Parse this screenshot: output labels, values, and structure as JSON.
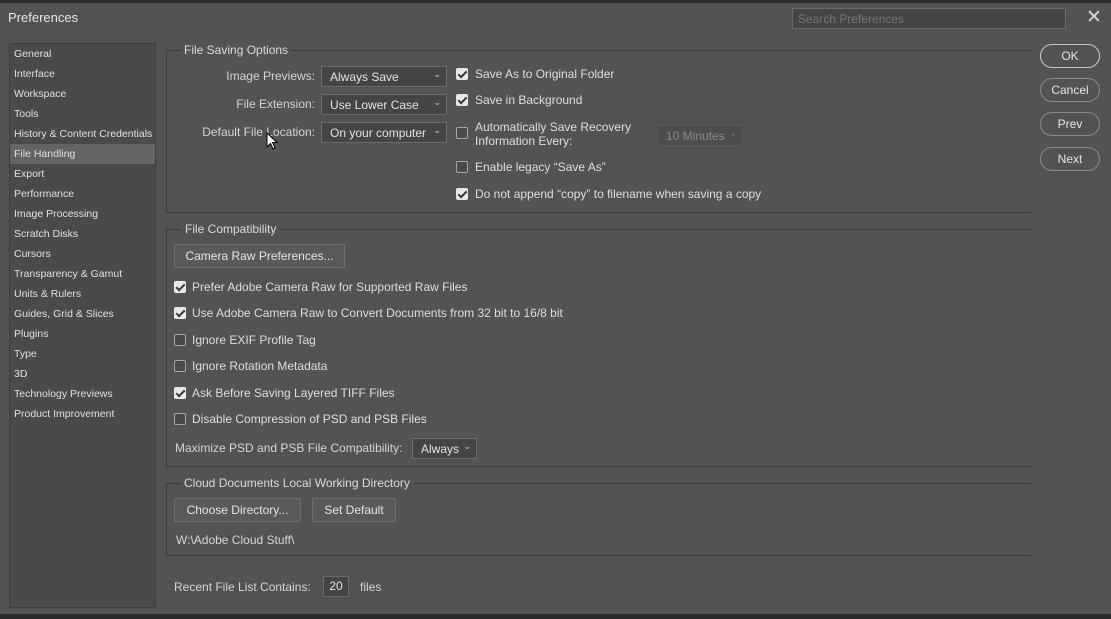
{
  "window": {
    "title": "Preferences",
    "search_placeholder": "Search Preferences",
    "close_glyph": "✕"
  },
  "sidebar": {
    "selected": "File Handling",
    "items": [
      {
        "label": "General"
      },
      {
        "label": "Interface"
      },
      {
        "label": "Workspace"
      },
      {
        "label": "Tools"
      },
      {
        "label": "History & Content Credentials"
      },
      {
        "label": "File Handling"
      },
      {
        "label": "Export"
      },
      {
        "label": "Performance"
      },
      {
        "label": "Image Processing"
      },
      {
        "label": "Scratch Disks"
      },
      {
        "label": "Cursors"
      },
      {
        "label": "Transparency & Gamut"
      },
      {
        "label": "Units & Rulers"
      },
      {
        "label": "Guides, Grid & Slices"
      },
      {
        "label": "Plugins"
      },
      {
        "label": "Type"
      },
      {
        "label": "3D"
      },
      {
        "label": "Technology Previews"
      },
      {
        "label": "Product Improvement"
      }
    ]
  },
  "file_saving": {
    "group_title": "File Saving Options",
    "image_previews_label": "Image Previews:",
    "image_previews_value": "Always Save",
    "file_extension_label": "File Extension:",
    "file_extension_value": "Use Lower Case",
    "default_location_label": "Default File Location:",
    "default_location_value": "On your computer",
    "save_original_folder": {
      "label": "Save As to Original Folder",
      "checked": true
    },
    "save_background": {
      "label": "Save in Background",
      "checked": true
    },
    "auto_recovery": {
      "label_line1": "Automatically Save Recovery",
      "label_line2": "Information Every:",
      "checked": false
    },
    "auto_recovery_interval": "10 Minutes",
    "legacy_save_as": {
      "label": "Enable legacy “Save As”",
      "checked": false
    },
    "no_append_copy": {
      "label": "Do not append “copy” to filename when saving a copy",
      "checked": true
    }
  },
  "file_compat": {
    "group_title": "File Compatibility",
    "camera_raw_button": "Camera Raw Preferences...",
    "prefer_acr": {
      "label": "Prefer Adobe Camera Raw for Supported Raw Files",
      "checked": true
    },
    "use_acr_convert": {
      "label": "Use Adobe Camera Raw to Convert Documents from 32 bit to 16/8 bit",
      "checked": true
    },
    "ignore_exif": {
      "label": "Ignore EXIF Profile Tag",
      "checked": false
    },
    "ignore_rotation": {
      "label": "Ignore Rotation Metadata",
      "checked": false
    },
    "ask_layered_tiff": {
      "label": "Ask Before Saving Layered TIFF Files",
      "checked": true
    },
    "disable_compression": {
      "label": "Disable Compression of PSD and PSB Files",
      "checked": false
    },
    "maximize_label": "Maximize PSD and PSB File Compatibility:",
    "maximize_value": "Always"
  },
  "cloud": {
    "group_title": "Cloud Documents Local Working Directory",
    "choose_button": "Choose Directory...",
    "default_button": "Set Default",
    "path": "W:\\Adobe Cloud Stuff\\"
  },
  "recent": {
    "label": "Recent File List Contains:",
    "value": "20",
    "suffix": "files"
  },
  "buttons": {
    "ok": "OK",
    "cancel": "Cancel",
    "prev": "Prev",
    "next": "Next"
  },
  "icons": {
    "close": "close-icon",
    "dropdown": "chevron-down-icon",
    "cursor": "mouse-pointer-icon"
  }
}
